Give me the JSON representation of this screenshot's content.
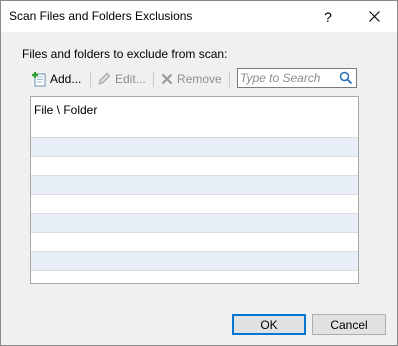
{
  "window": {
    "title": "Scan Files and Folders Exclusions",
    "help_label": "?"
  },
  "section_label": "Files and folders to exclude from scan:",
  "toolbar": {
    "add_label": "Add...",
    "edit_label": "Edit...",
    "remove_label": "Remove",
    "search_placeholder": "Type to Search"
  },
  "list": {
    "column_header": "File \\ Folder",
    "rows": [
      "",
      "",
      "",
      "",
      "",
      "",
      "",
      ""
    ]
  },
  "buttons": {
    "ok_label": "OK",
    "cancel_label": "Cancel"
  },
  "colors": {
    "dialog_background": "#f0f0f0",
    "alt_row": "#e9eff8",
    "default_button_border": "#0078d7"
  }
}
